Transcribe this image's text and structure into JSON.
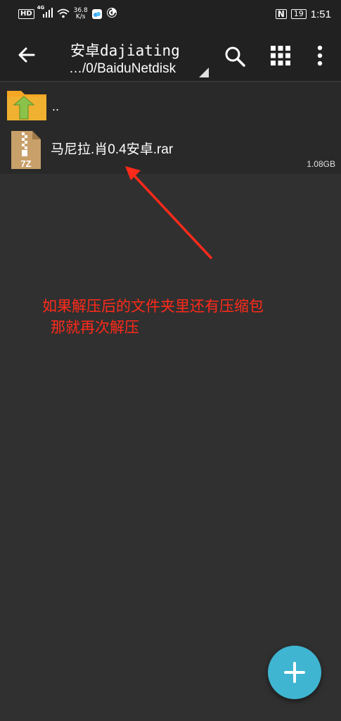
{
  "status_bar": {
    "hd": "HD",
    "network": "4G",
    "speed_value": "36.8",
    "speed_unit": "K/s",
    "battery": "19",
    "time": "1:51"
  },
  "app_bar": {
    "title": "安卓dajiating",
    "path": "…/0/BaiduNetdisk"
  },
  "file_list": {
    "parent_label": "..",
    "items": [
      {
        "name": "马尼拉.肖0.4安卓.rar",
        "size": "1.08GB",
        "type_label": "7Z"
      }
    ]
  },
  "annotation": {
    "line1": "如果解压后的文件夹里还有压缩包",
    "line2": "那就再次解压",
    "color": "#ff2a1a"
  },
  "colors": {
    "background": "#303030",
    "appbar": "#212121",
    "fab": "#3fb5d1"
  }
}
